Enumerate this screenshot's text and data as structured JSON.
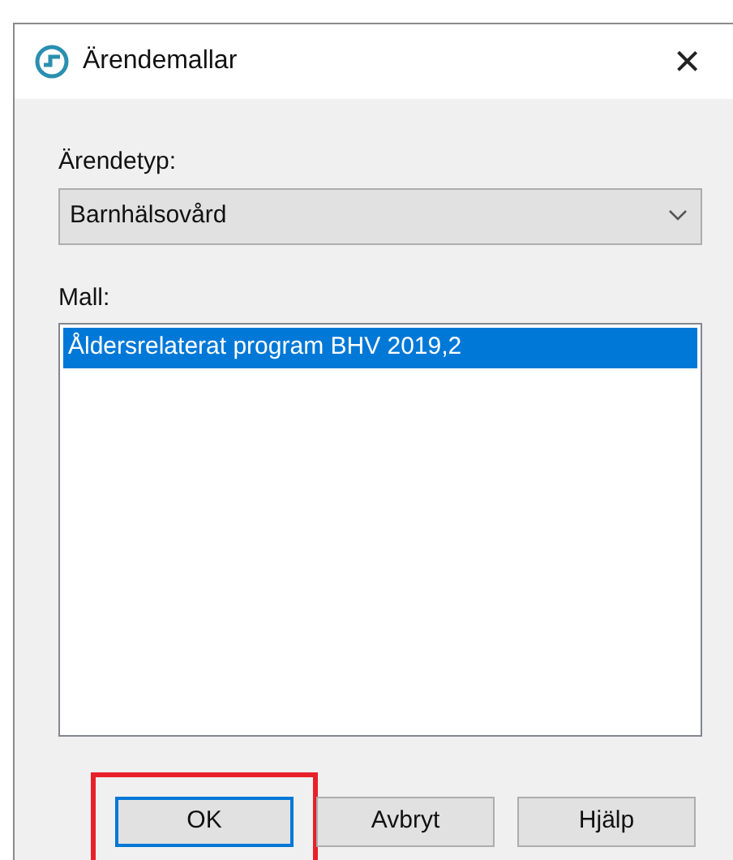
{
  "window": {
    "title": "Ärendemallar",
    "close": "×"
  },
  "case_type": {
    "label": "Ärendetyp:",
    "value": "Barnhälsovård"
  },
  "template": {
    "label": "Mall:",
    "items": [
      {
        "text": "Åldersrelaterat program BHV 2019,2",
        "selected": true
      }
    ]
  },
  "buttons": [
    {
      "label": "OK",
      "default": true,
      "highlighted": true
    },
    {
      "label": "Avbryt",
      "default": false,
      "highlighted": false
    },
    {
      "label": "Hjälp",
      "default": false,
      "highlighted": false
    }
  ]
}
